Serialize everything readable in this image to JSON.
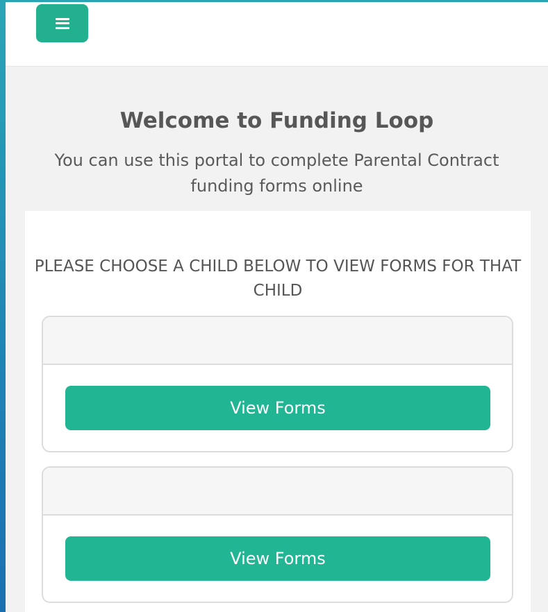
{
  "header": {
    "menu_icon": "hamburger-menu-icon",
    "accent_color": "#22b08f"
  },
  "welcome": {
    "title": "Welcome to Funding Loop",
    "subtitle": "You can use this portal to complete Parental Contract funding forms online"
  },
  "children_section": {
    "prompt": "PLEASE CHOOSE A CHILD BELOW TO VIEW FORMS FOR THAT CHILD",
    "cards": [
      {
        "button_label": "View Forms"
      },
      {
        "button_label": "View Forms"
      }
    ]
  }
}
